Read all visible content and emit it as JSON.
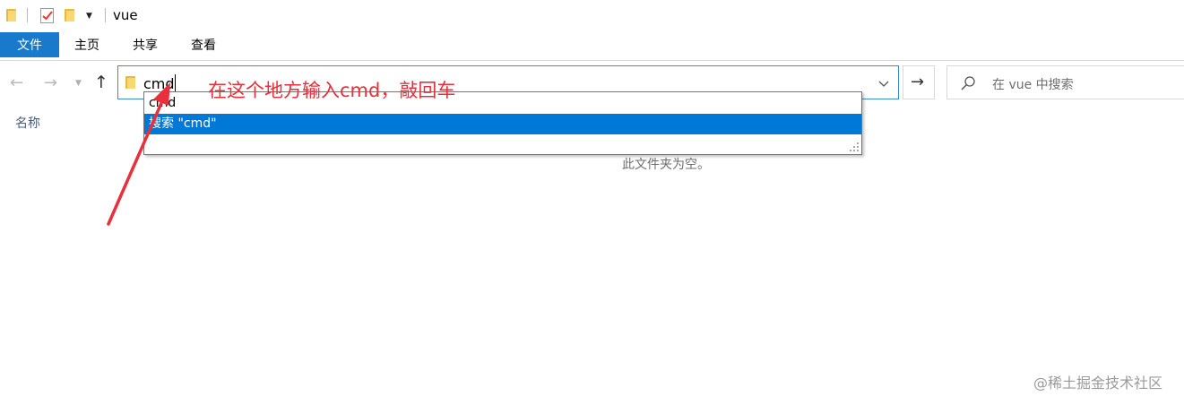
{
  "window": {
    "title": "vue"
  },
  "ribbon": {
    "tabs": [
      {
        "label": "文件"
      },
      {
        "label": "主页"
      },
      {
        "label": "共享"
      },
      {
        "label": "查看"
      }
    ]
  },
  "navigation": {
    "back_icon": "arrow-left-icon",
    "forward_icon": "arrow-right-icon",
    "recent_icon": "chevron-down-icon",
    "up_icon": "arrow-up-icon"
  },
  "address_bar": {
    "value": "cmd",
    "go_icon": "arrow-right-icon"
  },
  "search": {
    "placeholder": "在 vue 中搜索"
  },
  "autocomplete": {
    "items": [
      {
        "label": "cmd"
      },
      {
        "label": "搜索 \"cmd\""
      }
    ],
    "selected_index": 1
  },
  "content": {
    "column_header": "名称",
    "empty_message": "此文件夹为空。"
  },
  "annotation": {
    "text": "在这个地方输入cmd，敲回车",
    "color": "#e8303c"
  },
  "watermark": {
    "text": "@稀土掘金技术社区"
  },
  "colors": {
    "accent": "#1979ca",
    "selection": "#0078d7",
    "annotation": "#e8303c"
  }
}
